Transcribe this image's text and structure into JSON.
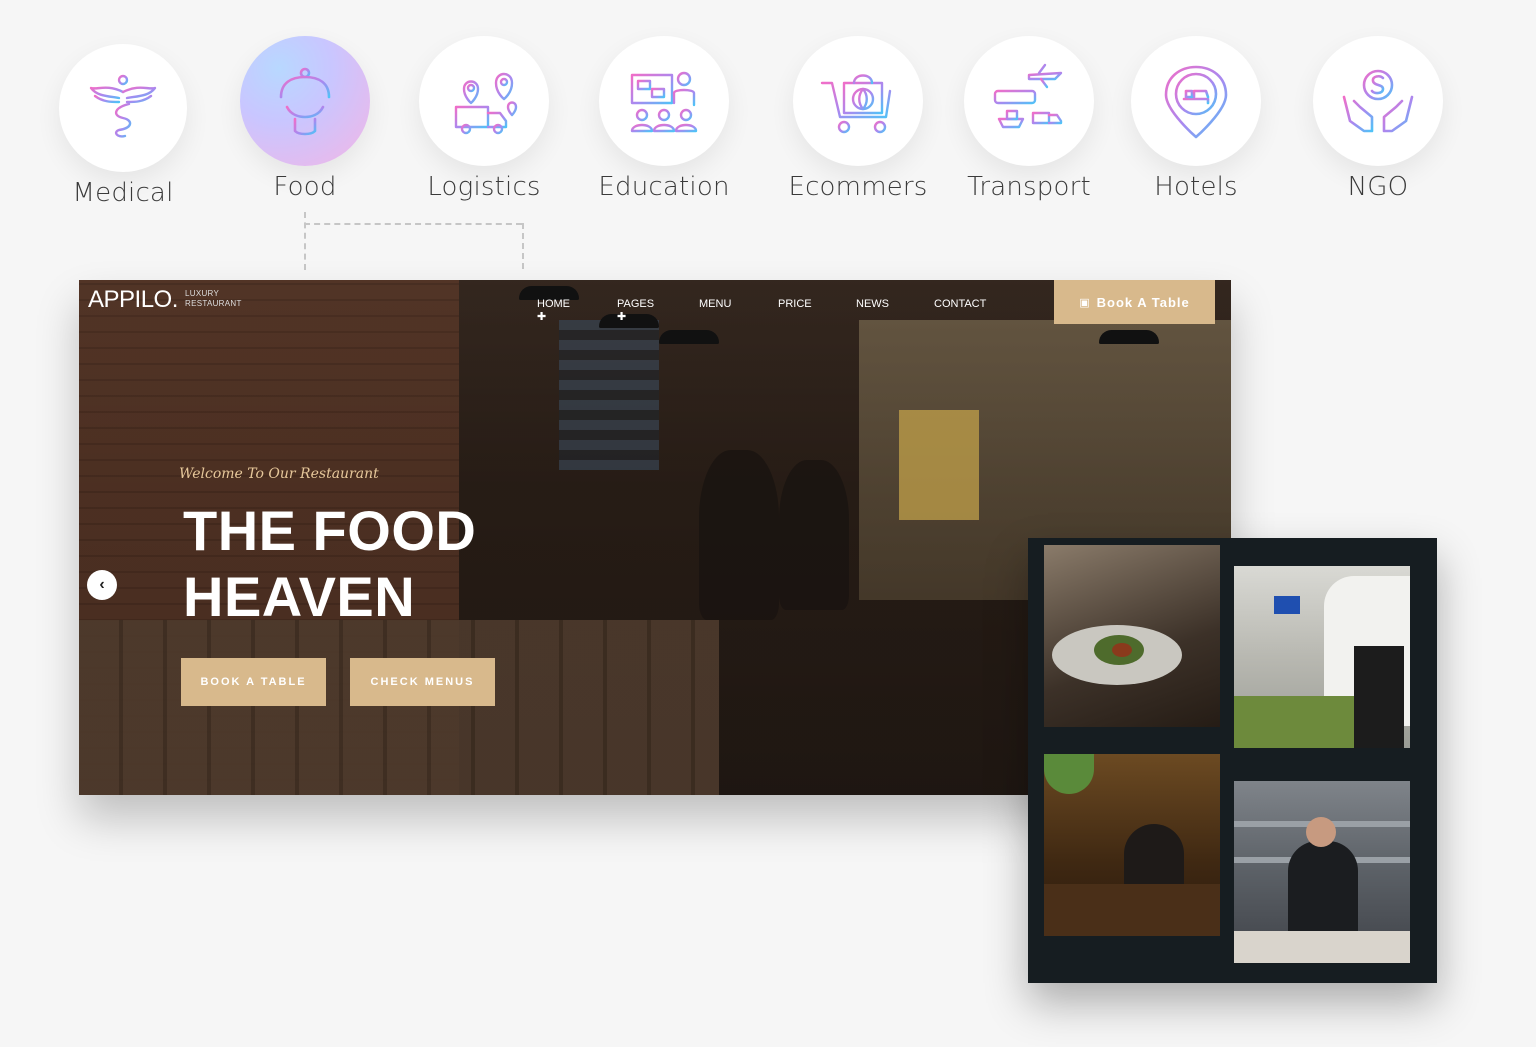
{
  "categories": [
    {
      "label": "Medical",
      "icon": "medical-caduceus-icon"
    },
    {
      "label": "Food",
      "icon": "food-cloche-icon",
      "active": true
    },
    {
      "label": "Logistics",
      "icon": "logistics-truck-map-icon"
    },
    {
      "label": "Education",
      "icon": "education-classroom-icon"
    },
    {
      "label": "Ecommers",
      "icon": "ecommerce-cart-icon"
    },
    {
      "label": "Transport",
      "icon": "transport-plane-train-ship-icon"
    },
    {
      "label": "Hotels",
      "icon": "hotel-bed-pin-icon"
    },
    {
      "label": "NGO",
      "icon": "ngo-hands-dollar-icon"
    }
  ],
  "hero": {
    "logo": "APPILO.",
    "logo_sub_1": "LUXURY",
    "logo_sub_2": "RESTAURANT",
    "nav": [
      {
        "label": "HOME ✚"
      },
      {
        "label": "PAGES ✚"
      },
      {
        "label": "MENU"
      },
      {
        "label": "PRICE"
      },
      {
        "label": "NEWS"
      },
      {
        "label": "CONTACT"
      }
    ],
    "book_top": "Book A Table",
    "welcome": "Welcome To Our Restaurant",
    "headline_1": "THE FOOD",
    "headline_2": "HEAVEN",
    "btn_book": "BOOK A TABLE",
    "btn_menu": "CHECK MENUS",
    "arrow": "‹"
  },
  "colors": {
    "accent": "#d8b98c",
    "gallery_bg": "#161d21",
    "icon_pink": "#f06ec8",
    "icon_blue": "#5fb6f5"
  }
}
